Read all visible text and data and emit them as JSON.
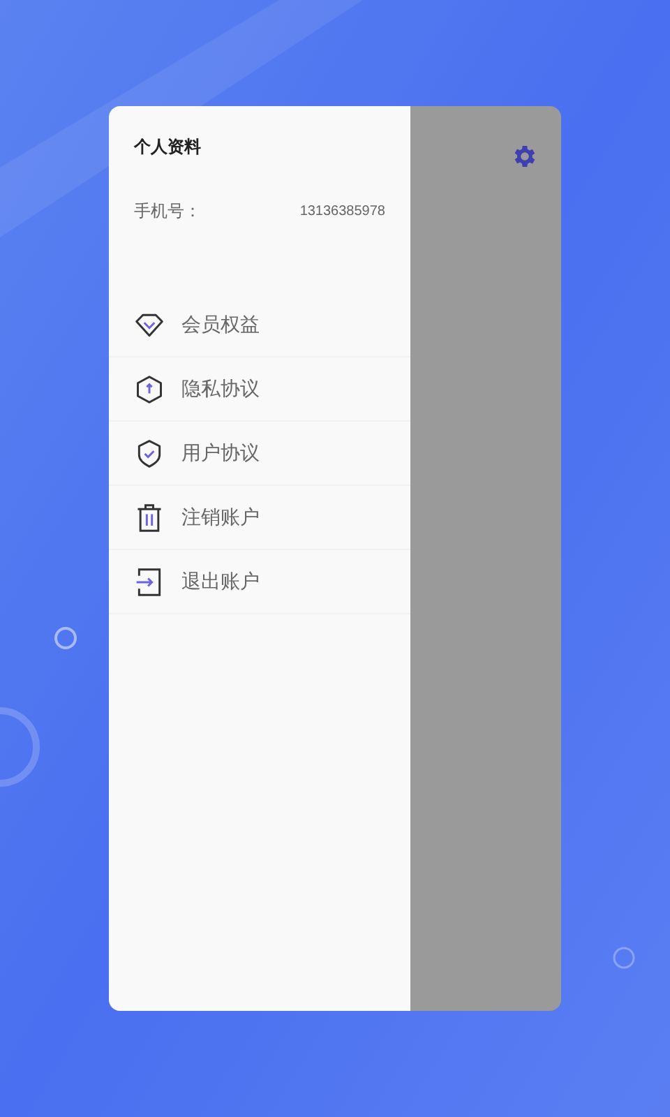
{
  "drawer": {
    "title": "个人资料",
    "phone_label": "手机号：",
    "phone_value": "13136385978",
    "items": [
      {
        "kind": "vip",
        "label": "会员权益"
      },
      {
        "kind": "privacy",
        "label": "隐私协议"
      },
      {
        "kind": "user",
        "label": "用户协议"
      },
      {
        "kind": "delete",
        "label": "注销账户"
      },
      {
        "kind": "logout",
        "label": "退出账户"
      }
    ]
  }
}
